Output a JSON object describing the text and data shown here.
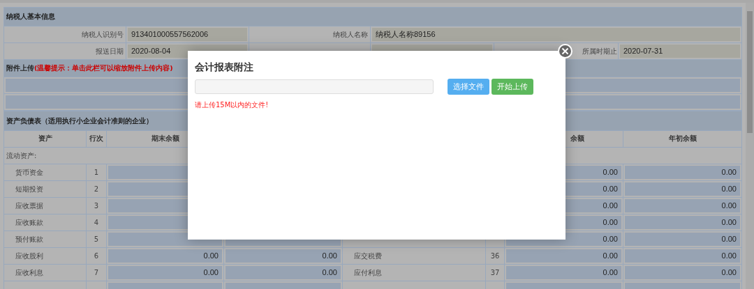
{
  "taxpayer_info": {
    "title": "纳税人基本信息",
    "fields": [
      {
        "label": "纳税人识别号",
        "value": "913401000557562006"
      },
      {
        "label": "纳税人名称",
        "value": "纳税人名称89156"
      },
      {
        "label": "报送日期",
        "value": "2020-08-04"
      },
      {
        "label": "所属时期止",
        "value": "2020-07-31"
      }
    ]
  },
  "attachment": {
    "label": "附件上传",
    "hint": "(温馨提示：单击此栏可以缩放附件上传内容)"
  },
  "balance_sheet": {
    "title": "资产负债表（适用执行小企业会计准则的企业）",
    "columns": {
      "column_1": "资产",
      "column_2": "行次",
      "column_3": "期末余额",
      "column_7": "余额",
      "column_8": "年初余额"
    },
    "section": "流动资产:",
    "rows": [
      {
        "asset": "货币资金",
        "line": "1",
        "liability_end": "0.00",
        "liability_begin": "0.00"
      },
      {
        "asset": "短期投资",
        "line": "2",
        "liability_end": "0.00",
        "liability_begin": "0.00"
      },
      {
        "asset": "应收票据",
        "line": "3",
        "liability_end": "0.00",
        "liability_begin": "0.00"
      },
      {
        "asset": "应收账款",
        "line": "4",
        "liability_end": "0.00",
        "liability_begin": "0.00"
      },
      {
        "asset": "预付账款",
        "line": "5",
        "liability_end": "0.00",
        "liability_begin": "0.00"
      },
      {
        "asset": "应收股利",
        "line": "6",
        "asset_end": "0.00",
        "asset_begin": "0.00",
        "liability": "应交税费",
        "liability_line": "36",
        "liability_end": "0.00",
        "liability_begin": "0.00"
      },
      {
        "asset": "应收利息",
        "line": "7",
        "asset_end": "0.00",
        "asset_begin": "0.00",
        "liability": "应付利息",
        "liability_line": "37",
        "liability_end": "0.00",
        "liability_begin": "0.00"
      }
    ]
  },
  "modal": {
    "title": "会计报表附注",
    "buttons": [
      {
        "label": "选择文件",
        "kind": "primary"
      },
      {
        "label": "开始上传",
        "kind": "success"
      }
    ],
    "note": "请上传15M以内的文件!"
  }
}
